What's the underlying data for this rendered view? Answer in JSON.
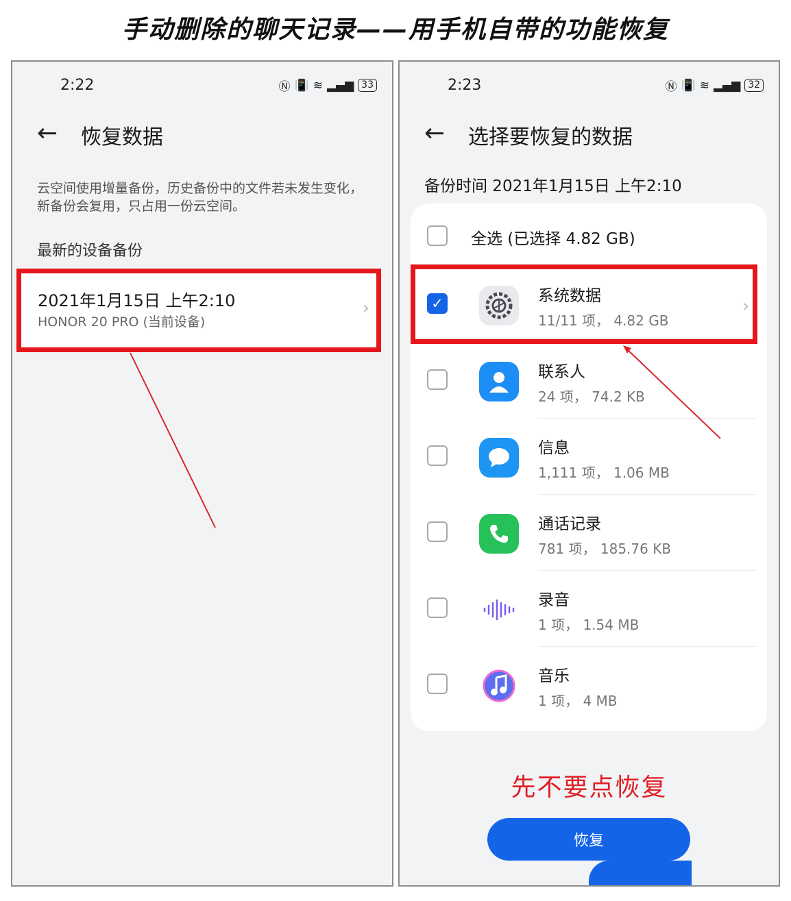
{
  "banner": {
    "title": "手动删除的聊天记录——用手机自带的功能恢复"
  },
  "left": {
    "status": {
      "time": "2:22",
      "battery": "33"
    },
    "title": "恢复数据",
    "description": "云空间使用增量备份，历史备份中的文件若未发生变化，新备份会复用，只占用一份云空间。",
    "section": "最新的设备备份",
    "backup": {
      "date": "2021年1月15日 上午2:10",
      "device": "HONOR 20 PRO (当前设备)"
    }
  },
  "right": {
    "status": {
      "time": "2:23",
      "battery": "32"
    },
    "title": "选择要恢复的数据",
    "backup_time": "备份时间 2021年1月15日 上午2:10",
    "select_all": "全选 (已选择 4.82 GB)",
    "items": [
      {
        "name": "系统数据",
        "detail": "11/11 项，  4.82 GB",
        "checked": true,
        "icon": "settings-gear-icon"
      },
      {
        "name": "联系人",
        "detail": "24 项，  74.2 KB",
        "checked": false,
        "icon": "contacts-icon"
      },
      {
        "name": "信息",
        "detail": "1,111 项，  1.06 MB",
        "checked": false,
        "icon": "messages-icon"
      },
      {
        "name": "通话记录",
        "detail": "781 项，  185.76 KB",
        "checked": false,
        "icon": "phone-icon"
      },
      {
        "name": "录音",
        "detail": "1 项，  1.54 MB",
        "checked": false,
        "icon": "voice-recorder-icon"
      },
      {
        "name": "音乐",
        "detail": "1 项，  4 MB",
        "checked": false,
        "icon": "music-icon"
      }
    ],
    "note": "先不要点恢复",
    "restore_button": "恢复"
  },
  "colors": {
    "accent": "#1464e8",
    "highlight": "#e5171c",
    "background": "#f1f3f5"
  }
}
